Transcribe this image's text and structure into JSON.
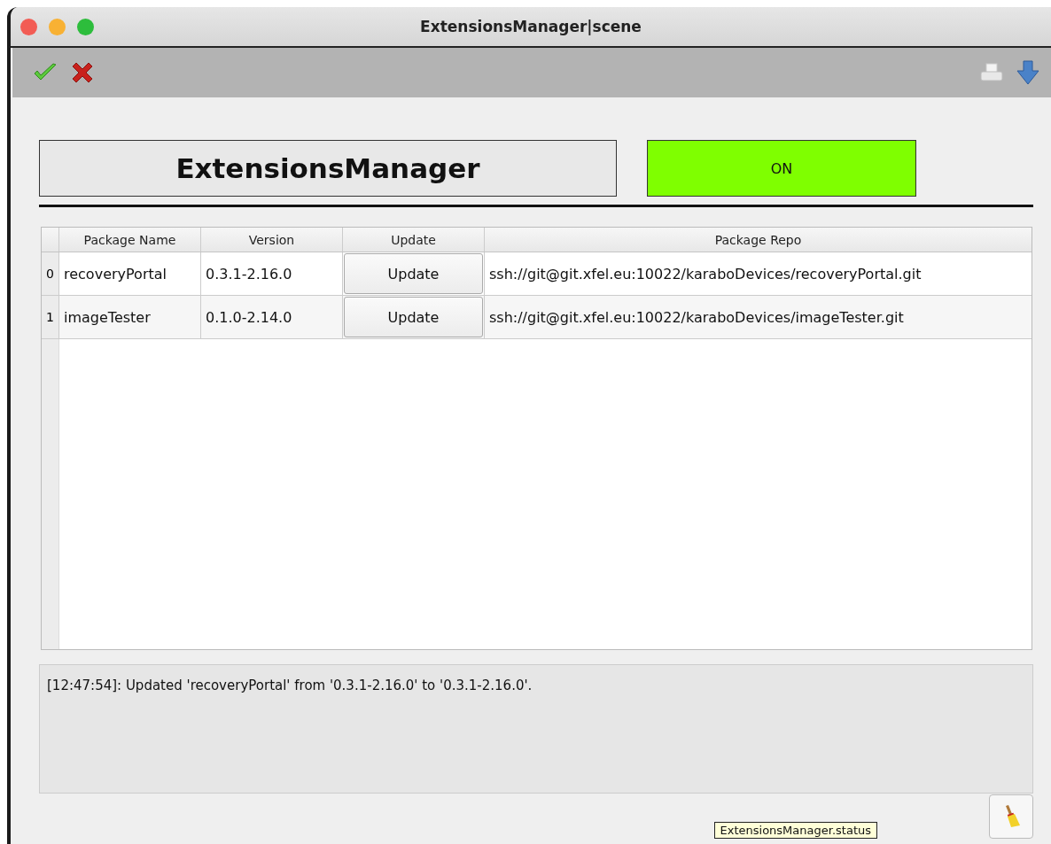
{
  "window": {
    "title": "ExtensionsManager|scene"
  },
  "device": {
    "name": "ExtensionsManager",
    "state": "ON",
    "color": "#7fff00"
  },
  "table": {
    "columns": [
      "Package Name",
      "Version",
      "Update",
      "Package Repo"
    ],
    "rows": [
      {
        "index": "0",
        "name": "recoveryPortal",
        "version": "0.3.1-2.16.0",
        "button": "Update",
        "repo": "ssh://git@git.xfel.eu:10022/karaboDevices/recoveryPortal.git"
      },
      {
        "index": "1",
        "name": "imageTester",
        "version": "0.1.0-2.14.0",
        "button": "Update",
        "repo": "ssh://git@git.xfel.eu:10022/karaboDevices/imageTester.git"
      }
    ]
  },
  "log": {
    "text": "[12:47:54]: Updated 'recoveryPortal' from '0.3.1-2.16.0' to '0.3.1-2.16.0'."
  },
  "tooltip": {
    "text": "ExtensionsManager.status"
  }
}
